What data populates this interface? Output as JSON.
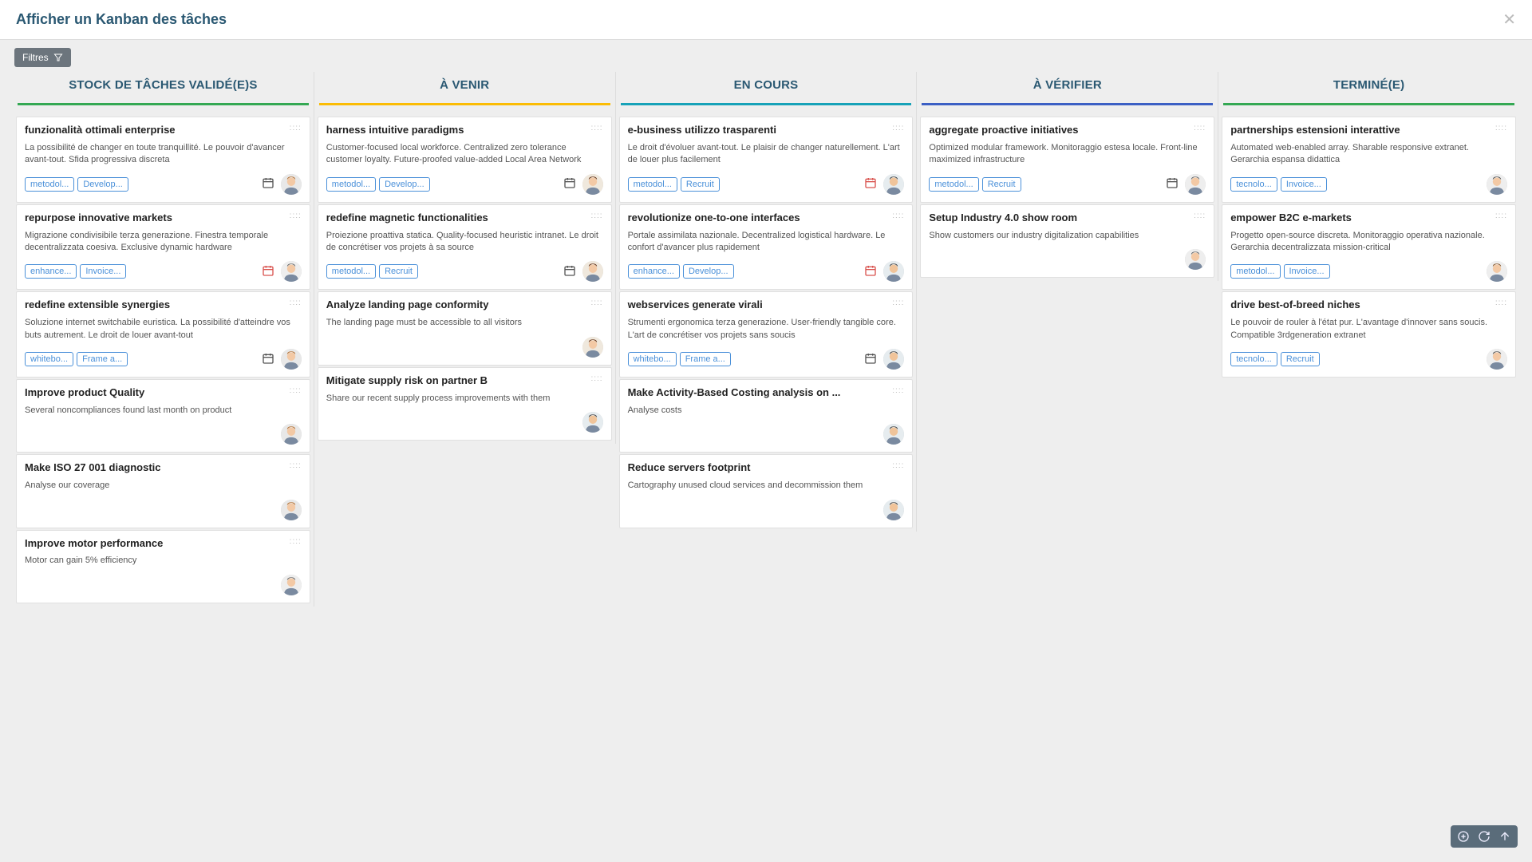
{
  "header": {
    "title": "Afficher un Kanban des tâches"
  },
  "toolbar": {
    "filter_label": "Filtres"
  },
  "columns": [
    {
      "title": "STOCK DE TÂCHES VALIDÉ(E)S",
      "color": "#34a853",
      "cards": [
        {
          "title": "funzionalità ottimali enterprise",
          "desc": "La possibilité de changer en toute tranquillité. Le pouvoir d'avancer avant-tout. Sfida progressiva discreta",
          "tags": [
            "metodol...",
            "Develop..."
          ],
          "cal": "black",
          "avatar": "f1"
        },
        {
          "title": "repurpose innovative markets",
          "desc": "Migrazione condivisibile terza generazione. Finestra temporale decentralizzata coesiva. Exclusive dynamic hardware",
          "tags": [
            "enhance...",
            "Invoice..."
          ],
          "cal": "red",
          "avatar": "m1"
        },
        {
          "title": "redefine extensible synergies",
          "desc": "Soluzione internet switchabile euristica. La possibilité d'atteindre vos buts autrement. Le droit de louer avant-tout",
          "tags": [
            "whitebo...",
            "Frame a..."
          ],
          "cal": "black",
          "avatar": "f1"
        },
        {
          "title": "Improve product Quality",
          "desc": "Several noncompliances found last month on product",
          "tags": [],
          "cal": null,
          "avatar": "f1"
        },
        {
          "title": "Make ISO 27 001 diagnostic",
          "desc": "Analyse our coverage",
          "tags": [],
          "cal": null,
          "avatar": "f1"
        },
        {
          "title": "Improve motor performance",
          "desc": "Motor can gain 5% efficiency",
          "tags": [],
          "cal": null,
          "avatar": "m1"
        }
      ]
    },
    {
      "title": "À VENIR",
      "color": "#fbbc04",
      "cards": [
        {
          "title": "harness intuitive paradigms",
          "desc": "Customer-focused local workforce. Centralized zero tolerance customer loyalty. Future-proofed value-added Local Area Network",
          "tags": [
            "metodol...",
            "Develop..."
          ],
          "cal": "black",
          "avatar": "f2"
        },
        {
          "title": "redefine magnetic functionalities",
          "desc": "Proiezione proattiva statica. Quality-focused heuristic intranet. Le droit de concrétiser vos projets à sa source",
          "tags": [
            "metodol...",
            "Recruit"
          ],
          "cal": "black",
          "avatar": "f2"
        },
        {
          "title": "Analyze landing page conformity",
          "desc": "The landing page must be accessible to all visitors",
          "tags": [],
          "cal": null,
          "avatar": "f2"
        },
        {
          "title": "Mitigate supply risk on partner B",
          "desc": "Share our recent supply process improvements with them",
          "tags": [],
          "cal": null,
          "avatar": "m2"
        }
      ]
    },
    {
      "title": "EN COURS",
      "color": "#17a2b8",
      "cards": [
        {
          "title": "e-business utilizzo trasparenti",
          "desc": "Le droit d'évoluer avant-tout. Le plaisir de changer naturellement. L'art de louer plus facilement",
          "tags": [
            "metodol...",
            "Recruit"
          ],
          "cal": "red",
          "avatar": "m2"
        },
        {
          "title": "revolutionize one-to-one interfaces",
          "desc": "Portale assimilata nazionale. Decentralized logistical hardware. Le confort d'avancer plus rapidement",
          "tags": [
            "enhance...",
            "Develop..."
          ],
          "cal": "red",
          "avatar": "m2"
        },
        {
          "title": "webservices generate virali",
          "desc": "Strumenti ergonomica terza generazione. User-friendly tangible core. L'art de concrétiser vos projets sans soucis",
          "tags": [
            "whitebo...",
            "Frame a..."
          ],
          "cal": "black",
          "avatar": "m2"
        },
        {
          "title": "Make Activity-Based Costing analysis on ...",
          "desc": "Analyse costs",
          "tags": [],
          "cal": null,
          "avatar": "m2"
        },
        {
          "title": "Reduce servers footprint",
          "desc": "Cartography unused cloud services and decommission them",
          "tags": [],
          "cal": null,
          "avatar": "m2"
        }
      ]
    },
    {
      "title": "À VÉRIFIER",
      "color": "#3b5fc4",
      "cards": [
        {
          "title": "aggregate proactive initiatives",
          "desc": "Optimized modular framework. Monitoraggio estesa locale. Front-line maximized infrastructure",
          "tags": [
            "metodol...",
            "Recruit"
          ],
          "cal": "black",
          "avatar": "m1"
        },
        {
          "title": "Setup Industry 4.0 show room",
          "desc": "Show customers our industry digitalization capabilities",
          "tags": [],
          "cal": null,
          "avatar": "m1"
        }
      ]
    },
    {
      "title": "TERMINÉ(E)",
      "color": "#34a853",
      "cards": [
        {
          "title": "partnerships estensioni interattive",
          "desc": "Automated web-enabled array. Sharable responsive extranet. Gerarchia espansa didattica",
          "tags": [
            "tecnolo...",
            "Invoice..."
          ],
          "cal": null,
          "avatar": "m3"
        },
        {
          "title": "empower B2C e-markets",
          "desc": "Progetto open-source discreta. Monitoraggio operativa nazionale. Gerarchia decentralizzata mission-critical",
          "tags": [
            "metodol...",
            "Invoice..."
          ],
          "cal": null,
          "avatar": "f3"
        },
        {
          "title": "drive best-of-breed niches",
          "desc": "Le pouvoir de rouler à l'état pur. L'avantage d'innover sans soucis. Compatible 3rdgeneration extranet",
          "tags": [
            "tecnolo...",
            "Recruit"
          ],
          "cal": null,
          "avatar": "m3"
        }
      ]
    }
  ]
}
